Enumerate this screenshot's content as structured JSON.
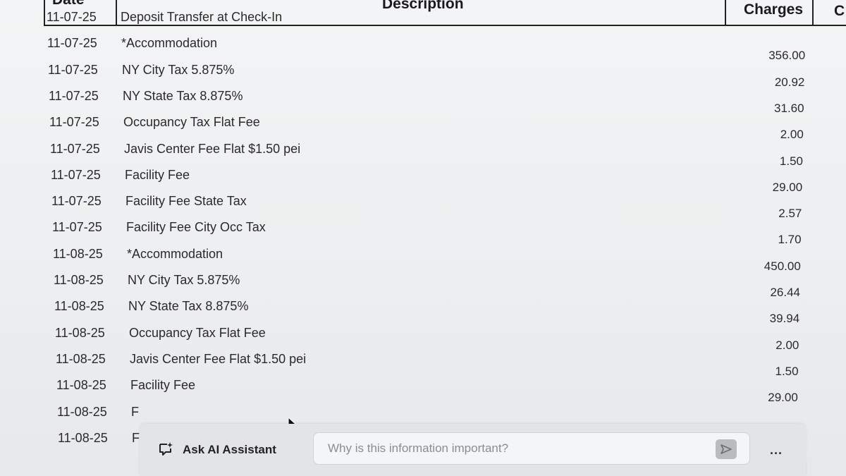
{
  "header": {
    "date": "Date",
    "description": "Description",
    "charges": "Charges",
    "credits": "C"
  },
  "rows": [
    {
      "date": "11-07-25",
      "description": "Deposit Transfer at Check-In",
      "amount": ""
    },
    {
      "date": "11-07-25",
      "description": "*Accommodation",
      "amount": "356.00"
    },
    {
      "date": "11-07-25",
      "description": "NY City Tax 5.875%",
      "amount": "20.92"
    },
    {
      "date": "11-07-25",
      "description": "NY State Tax 8.875%",
      "amount": "31.60"
    },
    {
      "date": "11-07-25",
      "description": "Occupancy Tax Flat Fee",
      "amount": "2.00"
    },
    {
      "date": "11-07-25",
      "description": "Javis Center Fee Flat $1.50 pei",
      "amount": "1.50"
    },
    {
      "date": "11-07-25",
      "description": "Facility Fee",
      "amount": "29.00"
    },
    {
      "date": "11-07-25",
      "description": "Facility Fee State Tax",
      "amount": "2.57"
    },
    {
      "date": "11-07-25",
      "description": "Facility Fee City Occ Tax",
      "amount": "1.70"
    },
    {
      "date": "11-08-25",
      "description": "*Accommodation",
      "amount": "450.00"
    },
    {
      "date": "11-08-25",
      "description": "NY City Tax 5.875%",
      "amount": "26.44"
    },
    {
      "date": "11-08-25",
      "description": "NY State Tax 8.875%",
      "amount": "39.94"
    },
    {
      "date": "11-08-25",
      "description": "Occupancy Tax Flat Fee",
      "amount": "2.00"
    },
    {
      "date": "11-08-25",
      "description": "Javis Center Fee Flat $1.50 pei",
      "amount": "1.50"
    },
    {
      "date": "11-08-25",
      "description": "Facility Fee",
      "amount": "29.00"
    },
    {
      "date": "11-08-25",
      "description": "F",
      "amount": ""
    },
    {
      "date": "11-08-25",
      "description": "F",
      "amount": ""
    }
  ],
  "ai_assistant": {
    "label": "Ask AI Assistant",
    "placeholder": "Why is this information important?",
    "more": "..."
  }
}
